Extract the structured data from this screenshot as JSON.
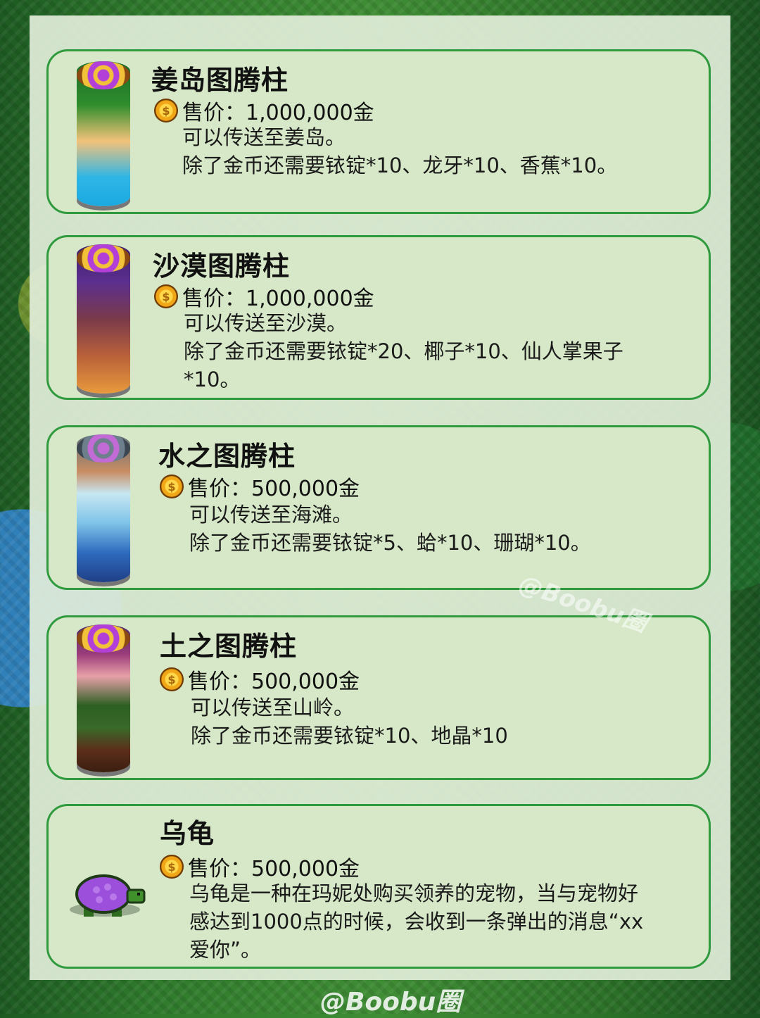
{
  "items": [
    {
      "title": "姜岛图腾柱",
      "price": "售价：1,000,000金",
      "desc": "可以传送至姜岛。\n除了金币还需要铱锭*10、龙牙*10、香蕉*10。",
      "pillar_colors": [
        "#1aa9e0",
        "#2f8d2c",
        "#f2c27a"
      ]
    },
    {
      "title": "沙漠图腾柱",
      "price": "售价：1,000,000金",
      "desc": "可以传送至沙漠。\n除了金币还需要铱锭*20、椰子*10、仙人掌果子\n*10。",
      "pillar_colors": [
        "#5b2f8f",
        "#b9613a",
        "#e89a3c"
      ]
    },
    {
      "title": "水之图腾柱",
      "price": "售价：500,000金",
      "desc": "可以传送至海滩。\n除了金币还需要铱锭*5、蛤*10、珊瑚*10。",
      "pillar_colors": [
        "#c98d63",
        "#7fc3e8",
        "#2a4f9c"
      ]
    },
    {
      "title": "土之图腾柱",
      "price": "售价：500,000金",
      "desc": "可以传送至山岭。\n除了金币还需要铱锭*10、地晶*10",
      "pillar_colors": [
        "#9b3c7a",
        "#2c5f22",
        "#5b2e1a"
      ]
    },
    {
      "title": "乌龟",
      "price": "售价：500,000金",
      "desc": "乌龟是一种在玛妮处购买领养的宠物，当与宠物好\n感达到1000点的时候，会收到一条弹出的消息“xx\n爱你”。",
      "pillar_colors": [
        "#9b4fdb",
        "#3f8f2a",
        "#2a5a1c"
      ]
    }
  ],
  "coin_symbol": "$",
  "watermark": "@Boobu圈",
  "watermark_overlay": "@Boobu圈"
}
